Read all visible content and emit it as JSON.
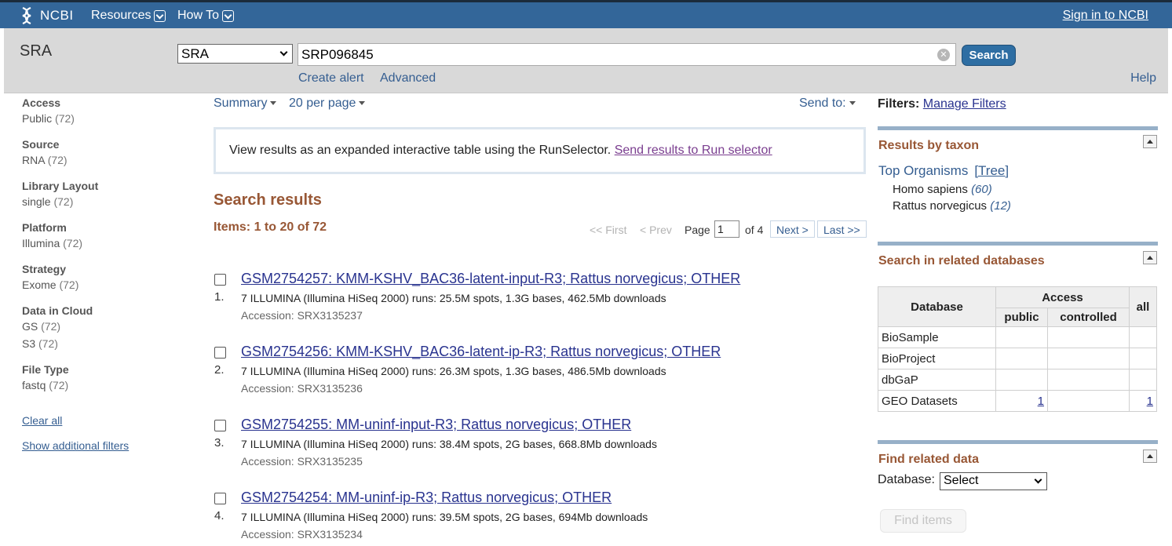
{
  "topbar": {
    "logo_text": "NCBI",
    "resources": "Resources",
    "howto": "How To",
    "signin": "Sign in to NCBI"
  },
  "search": {
    "db_title": "SRA",
    "db_selected": "SRA",
    "term": "SRP096845",
    "button": "Search",
    "create_alert": "Create alert",
    "advanced": "Advanced",
    "help": "Help"
  },
  "facets": [
    {
      "head": "Access",
      "items": [
        {
          "label": "Public",
          "count": "(72)"
        }
      ]
    },
    {
      "head": "Source",
      "items": [
        {
          "label": "RNA",
          "count": "(72)"
        }
      ]
    },
    {
      "head": "Library Layout",
      "items": [
        {
          "label": "single",
          "count": "(72)"
        }
      ]
    },
    {
      "head": "Platform",
      "items": [
        {
          "label": "Illumina",
          "count": "(72)"
        }
      ]
    },
    {
      "head": "Strategy",
      "items": [
        {
          "label": "Exome",
          "count": "(72)"
        }
      ]
    },
    {
      "head": "Data in Cloud",
      "items": [
        {
          "label": "GS",
          "count": "(72)"
        },
        {
          "label": "S3",
          "count": "(72)"
        }
      ]
    },
    {
      "head": "File Type",
      "items": [
        {
          "label": "fastq",
          "count": "(72)"
        }
      ]
    }
  ],
  "facet_links": {
    "clear_all": "Clear all",
    "show_additional": "Show additional filters"
  },
  "display": {
    "format": "Summary",
    "per_page": "20 per page",
    "send_to": "Send to:"
  },
  "runselector": {
    "text": "View results as an expanded interactive table using the RunSelector.",
    "link": "Send results to Run selector"
  },
  "results": {
    "title": "Search results",
    "items": "Items: 1 to 20 of 72",
    "list": [
      {
        "num": "1.",
        "title": "GSM2754257: KMM-KSHV_BAC36-latent-input-R3; Rattus norvegicus; OTHER",
        "desc": "7 ILLUMINA (Illumina HiSeq 2000) runs: 25.5M spots, 1.3G bases, 462.5Mb downloads",
        "accession": "Accession: SRX3135237"
      },
      {
        "num": "2.",
        "title": "GSM2754256: KMM-KSHV_BAC36-latent-ip-R3; Rattus norvegicus; OTHER",
        "desc": "7 ILLUMINA (Illumina HiSeq 2000) runs: 26.3M spots, 1.3G bases, 486.5Mb downloads",
        "accession": "Accession: SRX3135236"
      },
      {
        "num": "3.",
        "title": "GSM2754255: MM-uninf-input-R3; Rattus norvegicus; OTHER",
        "desc": "7 ILLUMINA (Illumina HiSeq 2000) runs: 38.4M spots, 2G bases, 668.8Mb downloads",
        "accession": "Accession: SRX3135235"
      },
      {
        "num": "4.",
        "title": "GSM2754254: MM-uninf-ip-R3; Rattus norvegicus; OTHER",
        "desc": "7 ILLUMINA (Illumina HiSeq 2000) runs: 39.5M spots, 2G bases, 694Mb downloads",
        "accession": "Accession: SRX3135234"
      }
    ]
  },
  "pager": {
    "first": "<< First",
    "prev": "< Prev",
    "page_label": "Page",
    "page_value": "1",
    "of": "of 4",
    "next": "Next >",
    "last": "Last >>"
  },
  "right": {
    "filters_label": "Filters:",
    "manage_filters": "Manage Filters",
    "taxon_title": "Results by taxon",
    "top_organisms": "Top Organisms",
    "tree": "[Tree]",
    "organisms": [
      {
        "name": "Homo sapiens",
        "count": "(60)"
      },
      {
        "name": "Rattus norvegicus",
        "count": "(12)"
      }
    ],
    "related_title": "Search in related databases",
    "table": {
      "col_database": "Database",
      "col_access": "Access",
      "col_all": "all",
      "col_public": "public",
      "col_controlled": "controlled",
      "rows": [
        {
          "db": "BioSample",
          "public": "",
          "controlled": "",
          "all": ""
        },
        {
          "db": "BioProject",
          "public": "",
          "controlled": "",
          "all": ""
        },
        {
          "db": "dbGaP",
          "public": "",
          "controlled": "",
          "all": ""
        },
        {
          "db": "GEO Datasets",
          "public": "1",
          "controlled": "",
          "all": "1"
        }
      ]
    },
    "find_title": "Find related data",
    "database_label": "Database:",
    "database_select": "Select",
    "find_items": "Find items"
  },
  "colors": {
    "header_blue": "#336699",
    "accent_brown": "#985735",
    "link_blue": "#355e91"
  }
}
